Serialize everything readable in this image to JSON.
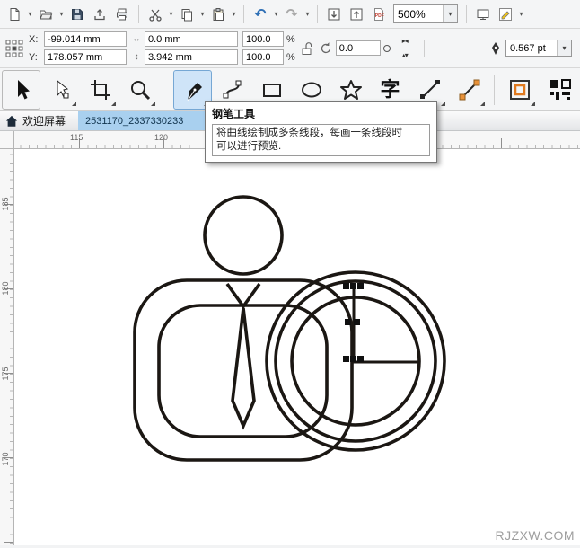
{
  "standard_toolbar": {
    "zoom_level": "500%",
    "pdf_label": "PDF"
  },
  "icons": {
    "caret_down": "▾",
    "undo": "↶",
    "redo": "↷",
    "width_arrow": "↔",
    "height_arrow": "↕",
    "mirror_horizontal": "▸◂",
    "mirror_vertical": "▴▾"
  },
  "property_bar": {
    "x_label": "X:",
    "y_label": "Y:",
    "x_value": "-99.014 mm",
    "y_value": "178.057 mm",
    "width_value": "0.0 mm",
    "height_value": "3.942 mm",
    "scale_h_value": "100.0",
    "scale_v_value": "100.0",
    "scale_unit": "%",
    "angle_value": "0.0",
    "outline_width_value": "0.567 pt"
  },
  "toolbox": {
    "text_tool_glyph": "字"
  },
  "tabs": {
    "welcome_label": "欢迎屏幕",
    "document_label": "2531170_2337330233"
  },
  "tooltip": {
    "title": "钢笔工具",
    "line1": "将曲线绘制成多条线段，每画一条线段时",
    "line2": "可以进行预览."
  },
  "rulers": {
    "horizontal_ticks": [
      "115",
      "120"
    ],
    "vertical_ticks": [
      "185",
      "180",
      "175",
      "170"
    ]
  },
  "canvas": {
    "watermark": "RJZXW.COM"
  },
  "colors": {
    "tool_active_bg": "#cfe4f8",
    "tool_active_border": "#76a7d4",
    "tab_active_bg": "#a9d0ef",
    "drawing_stroke": "#1b1713",
    "undo_enabled": "#2e6fb5"
  }
}
